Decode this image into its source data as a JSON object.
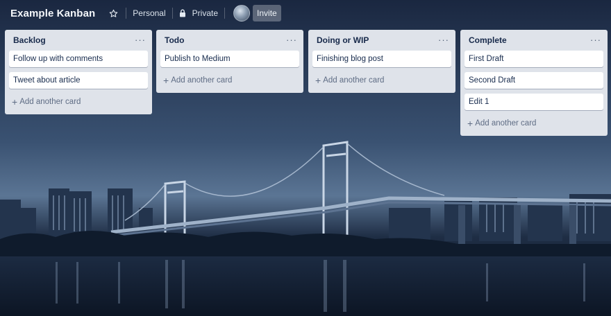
{
  "header": {
    "board_title": "Example Kanban",
    "visibility_team": "Personal",
    "visibility_privacy": "Private",
    "invite_label": "Invite"
  },
  "lists": [
    {
      "title": "Backlog",
      "menu": "···",
      "cards": [
        "Follow up with comments",
        "Tweet about article"
      ],
      "add_card": "Add another card"
    },
    {
      "title": "Todo",
      "menu": "···",
      "cards": [
        "Publish to Medium"
      ],
      "add_card": "Add another card"
    },
    {
      "title": "Doing or WIP",
      "menu": "···",
      "cards": [
        "Finishing blog post"
      ],
      "add_card": "Add another card"
    },
    {
      "title": "Complete",
      "menu": "···",
      "cards": [
        "First Draft",
        "Second Draft",
        "Edit 1"
      ],
      "add_card": "Add another card"
    }
  ],
  "colors": {
    "list_bg": "#dfe3ea",
    "card_bg": "#ffffff",
    "title_text": "#17294a",
    "muted_text": "#5e6c84"
  }
}
